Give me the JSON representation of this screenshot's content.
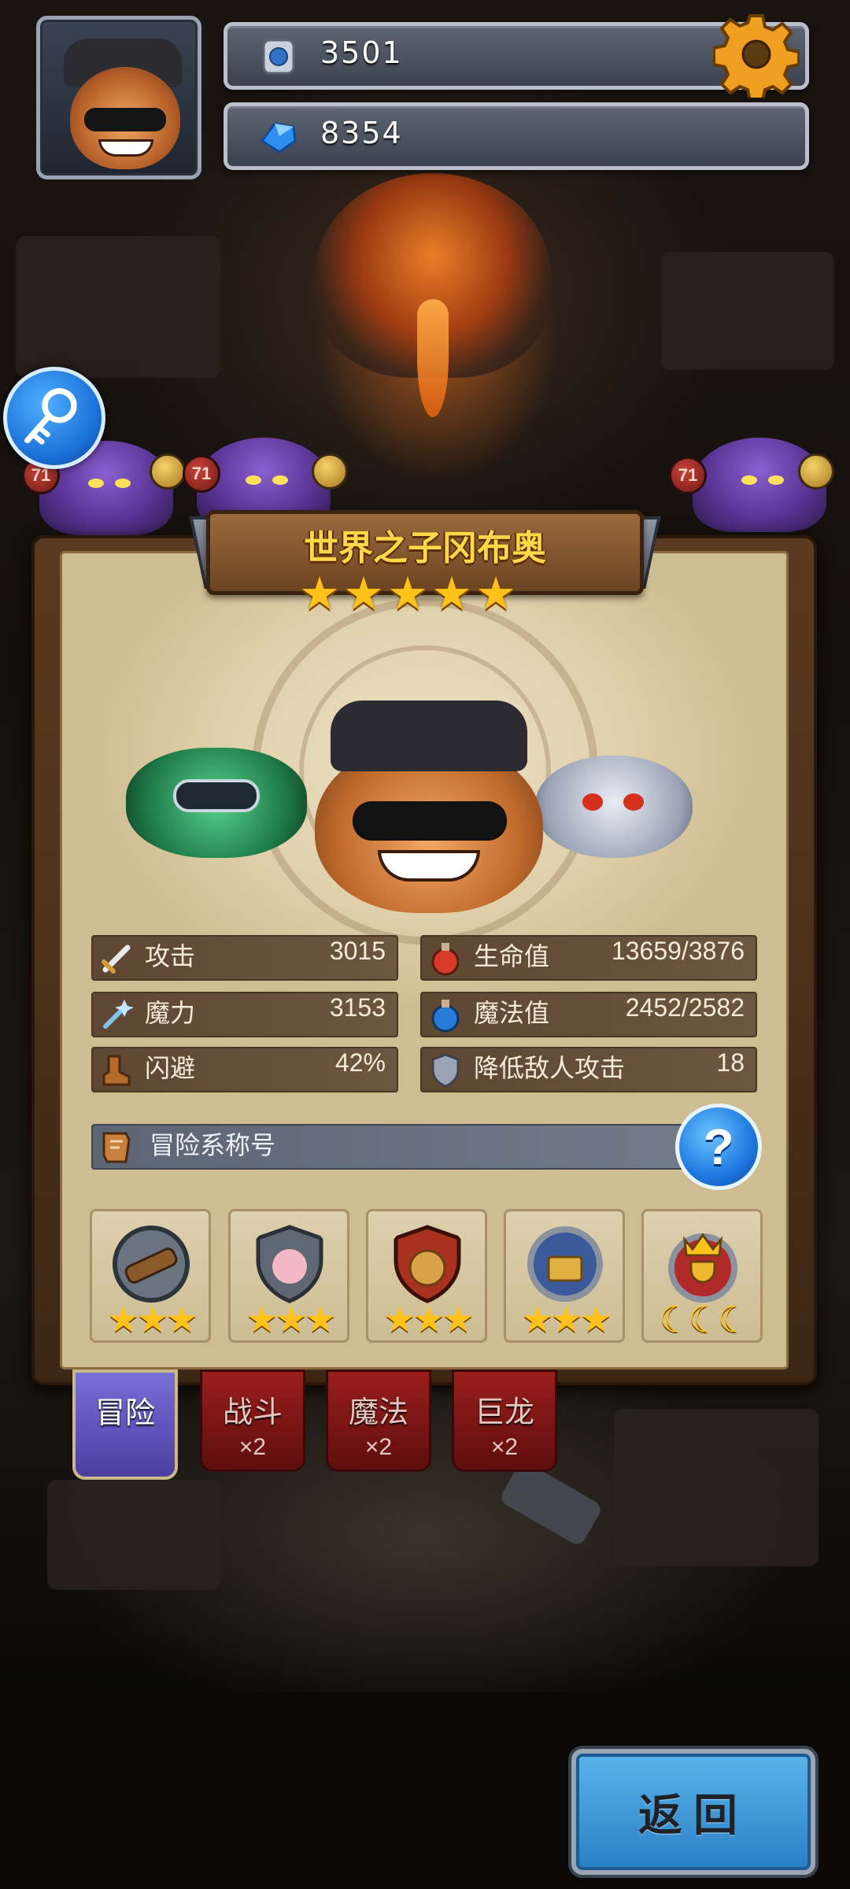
{
  "resources": {
    "silver": {
      "value": "3501",
      "icon": "silver-coin-icon"
    },
    "gems": {
      "value": "8354",
      "icon": "blue-gem-icon"
    }
  },
  "hero": {
    "name": "世界之子冈布奥",
    "stars": 5
  },
  "stats": {
    "attack": {
      "label": "攻击",
      "value": "3015",
      "icon": "sword-icon"
    },
    "magic": {
      "label": "魔力",
      "value": "3153",
      "icon": "magic-wand-icon"
    },
    "dodge": {
      "label": "闪避",
      "value": "42%",
      "icon": "boot-icon"
    },
    "hp": {
      "label": "生命值",
      "value": "13659/3876",
      "icon": "red-potion-icon"
    },
    "mp": {
      "label": "魔法值",
      "value": "2452/2582",
      "icon": "blue-potion-icon"
    },
    "armor": {
      "label": "降低敌人攻击",
      "value": "18",
      "icon": "shield-icon"
    }
  },
  "title_row": {
    "label": "冒险系称号",
    "help": "?"
  },
  "badges": [
    {
      "icon": "spyglass-badge-icon",
      "stars": 3,
      "star_color": "#ffc21a"
    },
    {
      "icon": "sheep-shield-badge-icon",
      "stars": 3,
      "star_color": "#ffc21a"
    },
    {
      "icon": "money-bag-badge-icon",
      "stars": 3,
      "star_color": "#ffc21a"
    },
    {
      "icon": "treasure-laurel-badge-icon",
      "stars": 3,
      "star_color": "#ffc21a"
    },
    {
      "icon": "crown-trophy-badge-icon",
      "stars": 3,
      "star_color": "#ffd24a",
      "star_shape": "crescent"
    }
  ],
  "tabs": [
    {
      "label": "冒险",
      "mult": "",
      "active": true
    },
    {
      "label": "战斗",
      "mult": "×2",
      "active": false
    },
    {
      "label": "魔法",
      "mult": "×2",
      "active": false
    },
    {
      "label": "巨龙",
      "mult": "×2",
      "active": false
    }
  ],
  "enemy_levels": [
    "71",
    "71",
    "71"
  ],
  "return_label": "返回",
  "colors": {
    "gold_text": "#ffd84a",
    "tab_active": "#5a4eb8",
    "tab_inactive": "#8a1a18",
    "button_blue": "#3a9ae0"
  }
}
